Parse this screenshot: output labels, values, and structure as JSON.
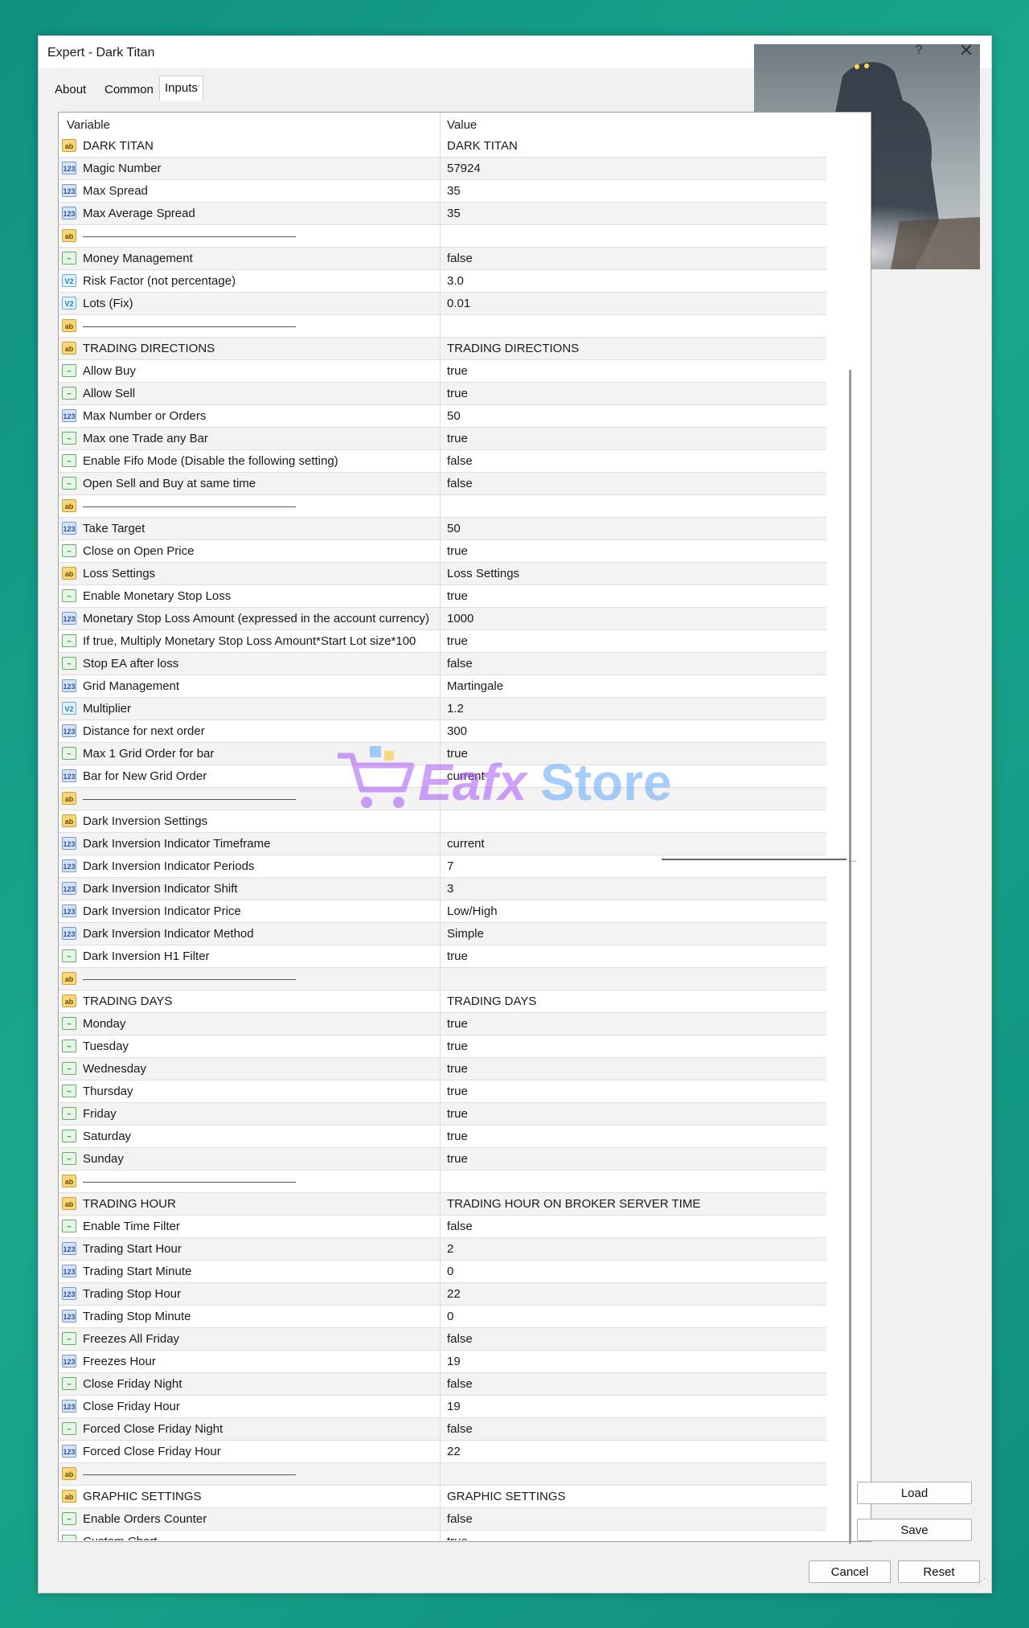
{
  "window": {
    "title": "Expert - Dark Titan",
    "help_label": "?",
    "close_label": "✕"
  },
  "tabs": [
    {
      "label": "About"
    },
    {
      "label": "Common"
    },
    {
      "label": "Inputs",
      "active": true
    }
  ],
  "columns": {
    "variable": "Variable",
    "value": "Value"
  },
  "rows": [
    {
      "type": "ab",
      "variable": "DARK TITAN",
      "value": "DARK TITAN"
    },
    {
      "type": "123",
      "variable": "Magic Number",
      "value": "57924"
    },
    {
      "type": "123",
      "variable": "Max Spread",
      "value": "35"
    },
    {
      "type": "123",
      "variable": "Max Average Spread",
      "value": "35"
    },
    {
      "type": "ab",
      "variable": "",
      "value": "",
      "separator": true
    },
    {
      "type": "bool",
      "variable": "Money Management",
      "value": "false"
    },
    {
      "type": "v2",
      "variable": "Risk Factor (not percentage)",
      "value": "3.0"
    },
    {
      "type": "v2",
      "variable": "Lots (Fix)",
      "value": "0.01"
    },
    {
      "type": "ab",
      "variable": "",
      "value": "",
      "separator": true
    },
    {
      "type": "ab",
      "variable": "TRADING DIRECTIONS",
      "value": "TRADING DIRECTIONS"
    },
    {
      "type": "bool",
      "variable": "Allow Buy",
      "value": "true"
    },
    {
      "type": "bool",
      "variable": "Allow Sell",
      "value": "true"
    },
    {
      "type": "123",
      "variable": "Max Number or Orders",
      "value": "50"
    },
    {
      "type": "bool",
      "variable": "Max one Trade any Bar",
      "value": "true"
    },
    {
      "type": "bool",
      "variable": "Enable Fifo Mode (Disable the following setting)",
      "value": "false"
    },
    {
      "type": "bool",
      "variable": "Open Sell and Buy at same time",
      "value": "false"
    },
    {
      "type": "ab",
      "variable": "",
      "value": "",
      "separator": true
    },
    {
      "type": "123",
      "variable": "Take Target",
      "value": "50"
    },
    {
      "type": "bool",
      "variable": "Close on Open Price",
      "value": "true"
    },
    {
      "type": "ab",
      "variable": "Loss Settings",
      "value": "Loss Settings"
    },
    {
      "type": "bool",
      "variable": "Enable Monetary Stop Loss",
      "value": "true"
    },
    {
      "type": "123",
      "variable": "Monetary Stop Loss Amount (expressed in the account currency)",
      "value": "1000"
    },
    {
      "type": "bool",
      "variable": "If true, Multiply Monetary Stop Loss Amount*Start Lot size*100",
      "value": "true"
    },
    {
      "type": "bool",
      "variable": "Stop EA after loss",
      "value": "false"
    },
    {
      "type": "123",
      "variable": "Grid Management",
      "value": "Martingale"
    },
    {
      "type": "v2",
      "variable": "Multiplier",
      "value": "1.2"
    },
    {
      "type": "123",
      "variable": "Distance for next order",
      "value": "300"
    },
    {
      "type": "bool",
      "variable": "Max 1 Grid Order for bar",
      "value": "true"
    },
    {
      "type": "123",
      "variable": "Bar for New Grid Order",
      "value": "current"
    },
    {
      "type": "ab",
      "variable": "",
      "value": "",
      "separator": true
    },
    {
      "type": "ab",
      "variable": "Dark Inversion Settings",
      "value": ""
    },
    {
      "type": "123",
      "variable": "Dark Inversion Indicator Timeframe",
      "value": "current"
    },
    {
      "type": "123",
      "variable": "Dark Inversion Indicator Periods",
      "value": "7"
    },
    {
      "type": "123",
      "variable": "Dark Inversion Indicator Shift",
      "value": "3"
    },
    {
      "type": "123",
      "variable": "Dark Inversion Indicator Price",
      "value": "Low/High"
    },
    {
      "type": "123",
      "variable": "Dark Inversion Indicator Method",
      "value": "Simple"
    },
    {
      "type": "bool",
      "variable": "Dark Inversion H1 Filter",
      "value": "true"
    },
    {
      "type": "ab",
      "variable": "",
      "value": "",
      "separator": true
    },
    {
      "type": "ab",
      "variable": "TRADING DAYS",
      "value": "TRADING DAYS"
    },
    {
      "type": "bool",
      "variable": "Monday",
      "value": "true"
    },
    {
      "type": "bool",
      "variable": "Tuesday",
      "value": "true"
    },
    {
      "type": "bool",
      "variable": "Wednesday",
      "value": "true"
    },
    {
      "type": "bool",
      "variable": "Thursday",
      "value": "true"
    },
    {
      "type": "bool",
      "variable": "Friday",
      "value": "true"
    },
    {
      "type": "bool",
      "variable": "Saturday",
      "value": "true"
    },
    {
      "type": "bool",
      "variable": "Sunday",
      "value": "true"
    },
    {
      "type": "ab",
      "variable": "",
      "value": "",
      "separator": true
    },
    {
      "type": "ab",
      "variable": "TRADING HOUR",
      "value": "TRADING HOUR ON BROKER SERVER TIME"
    },
    {
      "type": "bool",
      "variable": "Enable Time Filter",
      "value": "false"
    },
    {
      "type": "123",
      "variable": "Trading Start Hour",
      "value": "2"
    },
    {
      "type": "123",
      "variable": "Trading Start Minute",
      "value": "0"
    },
    {
      "type": "123",
      "variable": "Trading Stop Hour",
      "value": "22"
    },
    {
      "type": "123",
      "variable": "Trading Stop Minute",
      "value": "0"
    },
    {
      "type": "bool",
      "variable": "Freezes All Friday",
      "value": "false"
    },
    {
      "type": "123",
      "variable": "Freezes Hour",
      "value": "19"
    },
    {
      "type": "bool",
      "variable": "Close Friday Night",
      "value": "false"
    },
    {
      "type": "123",
      "variable": "Close Friday Hour",
      "value": "19"
    },
    {
      "type": "bool",
      "variable": "Forced Close Friday Night",
      "value": "false"
    },
    {
      "type": "123",
      "variable": "Forced Close Friday Hour",
      "value": "22"
    },
    {
      "type": "ab",
      "variable": "",
      "value": "",
      "separator": true
    },
    {
      "type": "ab",
      "variable": "GRAPHIC SETTINGS",
      "value": "GRAPHIC SETTINGS"
    },
    {
      "type": "bool",
      "variable": "Enable Orders Counter",
      "value": "false"
    },
    {
      "type": "bool",
      "variable": "Custom Chart",
      "value": "true"
    }
  ],
  "icon_labels": {
    "ab": "ab",
    "123": "123",
    "v2": "V2",
    "bool": "~"
  },
  "buttons": {
    "load": "Load",
    "save": "Save",
    "cancel": "Cancel",
    "reset": "Reset"
  },
  "watermark": {
    "text_a": "Eafx",
    "text_b": "Store"
  },
  "colors": {
    "accent_teal": "#10907e",
    "watermark_purple": "#a855f7",
    "watermark_blue": "#60a5fa"
  }
}
